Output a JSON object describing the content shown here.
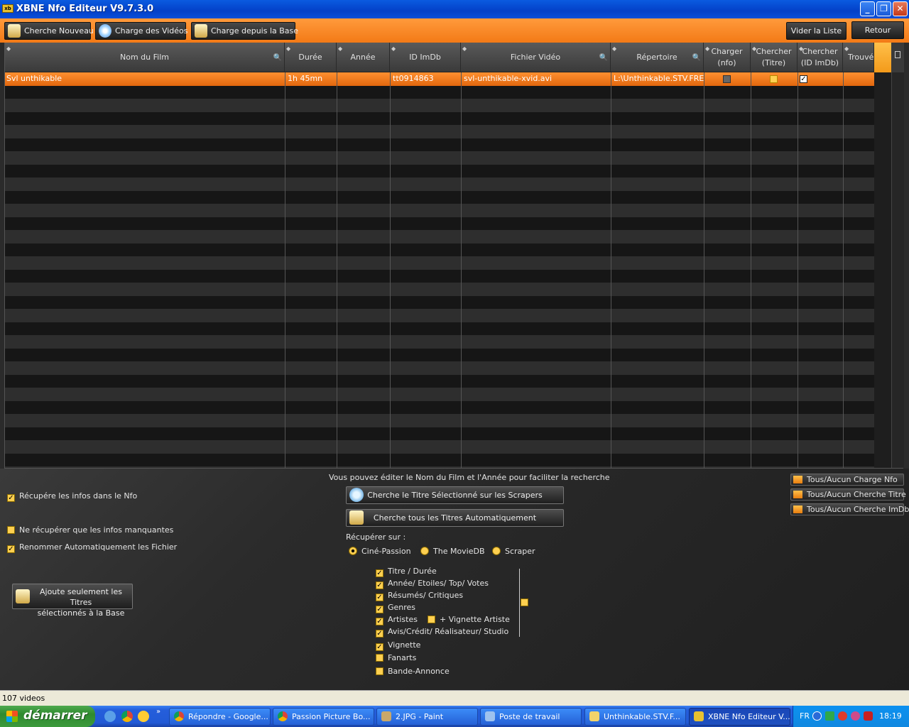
{
  "window": {
    "title": "XBNE Nfo Editeur V9.7.3.0",
    "icon_name": "app-icon"
  },
  "toolbar": {
    "search_new": "Cherche Nouveau",
    "load_videos": "Charge des Vidéos",
    "load_from_base": "Charge depuis la Base",
    "clear_list": "Vider la Liste",
    "back": "Retour"
  },
  "grid": {
    "columns": {
      "film_name": "Nom du Film",
      "duration": "Durée",
      "year": "Année",
      "imdb_id": "ID ImDb",
      "video_file": "Fichier Vidéo",
      "directory": "Répertoire",
      "load_nfo": "Charger (nfo)",
      "search_title": "Chercher (Titre)",
      "search_imdb": "Chercher (ID ImDb)",
      "found": "Trouvé"
    },
    "rows": [
      {
        "film_name": "Svl unthikable",
        "duration": "1h 45mn",
        "year": "",
        "imdb_id": "tt0914863",
        "video_file": "svl-unthikable-xvid.avi",
        "directory": "L:\\Unthinkable.STV.FREN",
        "load_nfo": false,
        "search_title": false,
        "search_imdb": true
      }
    ]
  },
  "lower": {
    "hint": "Vous pouvez éditer le Nom du Film et l'Année pour faciliter la recherche",
    "fetch_nfo": "Récupére les infos dans le Nfo",
    "only_missing": "Ne récupérer que les infos manquantes",
    "auto_rename": "Renommer Automatiquement les Fichier",
    "add_selected_line1": "Ajoute seulement les Titres",
    "add_selected_line2": "sélectionnés à la Base",
    "search_selected": "Cherche le Titre Sélectionné sur les Scrapers",
    "search_all": "Cherche tous les Titres Automatiquement",
    "fetch_from": "Récupérer sur :",
    "sources": [
      "Ciné-Passion",
      "The MovieDB",
      "Scraper"
    ],
    "selected_source": "Ciné-Passion",
    "fields": {
      "title_duration": "Titre / Durée",
      "year_stars": "Année/ Etoiles/ Top/ Votes",
      "summaries": "Résumés/ Critiques",
      "genres": "Genres",
      "artists": "Artistes",
      "artist_thumb": "+ Vignette Artiste",
      "credits": "Avis/Crédit/ Réalisateur/ Studio",
      "thumbnail": "Vignette",
      "fanarts": "Fanarts",
      "trailer": "Bande-Annonce"
    },
    "toggle_all_nfo": "Tous/Aucun Charge Nfo",
    "toggle_all_title": "Tous/Aucun Cherche Titre",
    "toggle_all_imdb": "Tous/Aucun Cherche ImDb"
  },
  "status": {
    "count": "107 videos"
  },
  "taskbar": {
    "start": "démarrer",
    "items": [
      "Répondre - Google...",
      "Passion Picture Bo...",
      "2.JPG - Paint",
      "Poste de travail",
      "Unthinkable.STV.F...",
      "XBNE Nfo Editeur V..."
    ],
    "lang": "FR",
    "clock": "18:19"
  },
  "colors": {
    "accent": "#f37a16",
    "selection": "#ff9030",
    "taskbar": "#245edb"
  }
}
